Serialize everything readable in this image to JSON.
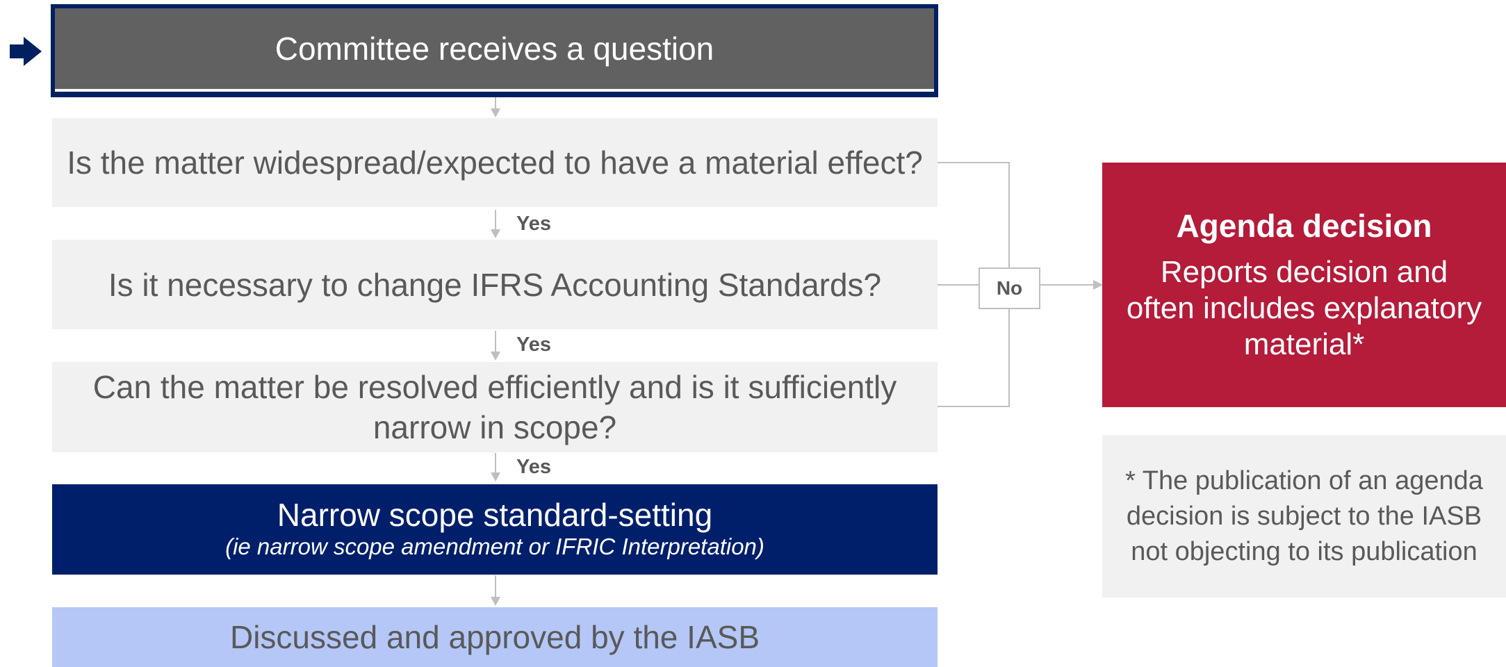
{
  "start": {
    "label": "Committee receives a question"
  },
  "questions": [
    {
      "label": "Is the matter widespread/expected to have a material effect?"
    },
    {
      "label": "Is it necessary to change IFRS Accounting Standards?"
    },
    {
      "label": "Can the matter be resolved efficiently and is it sufficiently narrow in scope?"
    }
  ],
  "yes_labels": [
    "Yes",
    "Yes",
    "Yes"
  ],
  "no_label": "No",
  "standard_setting": {
    "title": "Narrow scope standard-setting",
    "subtitle": "(ie narrow scope amendment or IFRIC Interpretation)"
  },
  "final_step": {
    "label": "Discussed and approved by the IASB"
  },
  "agenda_decision": {
    "title": "Agenda decision",
    "body": "Reports decision and often includes explanatory material*"
  },
  "footnote": {
    "text": "* The publication of an agenda decision is subject to the IASB not objecting to its publication"
  },
  "colors": {
    "start_fill": "#616161",
    "start_border": "#002060",
    "question_fill": "#f1f1f1",
    "navy": "#001f6b",
    "light_blue": "#b4c7f7",
    "crimson": "#b41c3a",
    "connector": "#bfbfbf",
    "text_grey": "#595959"
  }
}
